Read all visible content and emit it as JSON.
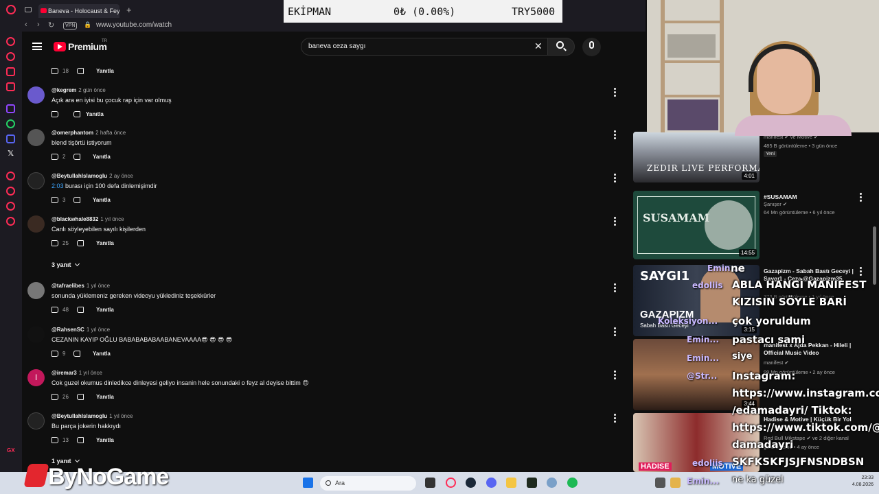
{
  "browser": {
    "tab_title": "Baneva - Holocaust & Feyz",
    "new_tab": "+",
    "vpn": "VPN",
    "url": "www.youtube.com/watch",
    "back": "‹",
    "forward": "›",
    "reload": "↻"
  },
  "youtube": {
    "brand": "Premium",
    "region": "TR",
    "search_query": "baneva ceza saygı",
    "clear": "✕"
  },
  "comments": [
    {
      "likes": "18",
      "reply": "Yanıtla"
    },
    {
      "handle": "@kegrem",
      "time": "2 gün önce",
      "text": "Açık ara en iyisi bu çocuk rap için var olmuş",
      "likes": "",
      "reply": "Yanıtla"
    },
    {
      "handle": "@omerphantom",
      "time": "2 hafta önce",
      "text": "blend tişörtü istiyorum",
      "likes": "2",
      "reply": "Yanıtla"
    },
    {
      "handle": "@BeytullahIslamoglu",
      "time": "2 ay önce",
      "timestamp": "2:03",
      "text": " burası için 100 defa dinlemişimdir",
      "likes": "3",
      "reply": "Yanıtla"
    },
    {
      "handle": "@blackwhale8832",
      "time": "1 yıl önce",
      "text": "Canlı söyleyebilen sayılı kişilerden",
      "likes": "25",
      "reply": "Yanıtla",
      "replies": "3 yanıt"
    },
    {
      "handle": "@tafraelibes",
      "time": "1 yıl önce",
      "text": "sonunda yüklemeniz gereken videoyu yüklediniz teşekkürler",
      "likes": "48",
      "reply": "Yanıtla"
    },
    {
      "handle": "@RahsenSC",
      "time": "1 yıl önce",
      "text": "CEZANIN KAYIP OĞLU BABABABABAABANEVAAAA😎 😎 😎 😎",
      "likes": "9",
      "reply": "Yanıtla"
    },
    {
      "handle": "@iremar3",
      "time": "1 yıl önce",
      "text": "Cok guzel okumus dinledikce dinleyesi geliyo insanin hele sonundaki o feyz al deyise bittim 😍",
      "likes": "26",
      "reply": "Yanıtla",
      "avatar_letter": "I"
    },
    {
      "handle": "@BeytullahIslamoglu",
      "time": "1 yıl önce",
      "text": "Bu parça jokerin hakkıydı",
      "likes": "13",
      "reply": "Yanıtla",
      "replies": "1 yanıt"
    }
  ],
  "recommendations": [
    {
      "channel": "manifest ✔ ve Motive ✔",
      "meta": "485 B görüntüleme • 3 gün önce",
      "badge": "Yeni",
      "duration": "4:01",
      "thumb_text": "ZEDIR LIVE PERFORMANCE"
    },
    {
      "title": "#SUSAMAM",
      "channel": "Şanışer ✔",
      "meta": "64 Mn görüntüleme • 6 yıl önce",
      "duration": "14:55",
      "thumb_text": "SUSAMAM"
    },
    {
      "title": "Gazapizm - Sabah Bastı Geceyi | Saygı1 - Ceza @Gazapizm35",
      "meta": "373 B görüntüleme • 1 yıl önce",
      "duration": "3:15",
      "thumb_text": "SAYGI1",
      "thumb_sub": "GAZAPIZM",
      "thumb_sub2": "Sabah Bastı Geceyi"
    },
    {
      "title": "manifest x Ajda Pekkan - Hileli | Official Music Video",
      "channel": "manifest ✔",
      "meta": "99 Mn görüntüleme • 2 ay önce",
      "duration": "3:44"
    },
    {
      "title": "Hadise & Motive | Küçük Bir Yol",
      "channel": "Red Bull Mikstape ✔ ve 2 diğer kanal",
      "meta": "görüntüleme • 4 ay önce",
      "thumb_text": "HADISE",
      "thumb_text2": "MOTIVE"
    }
  ],
  "stats": {
    "label": "EKİPMAN",
    "value": "0₺ (0.00%)",
    "total": "TRY5000"
  },
  "chat": [
    {
      "name": "Emin...",
      "text": "ne"
    },
    {
      "name": "edoliis",
      "text": "ABLA HANGİ MANIFEST KIZISIN SÖYLE BARİ"
    },
    {
      "name": "Koleksiyon...",
      "text": "çok yoruldum"
    },
    {
      "name": "Emin...",
      "text": "pastacı sami"
    },
    {
      "name": "Emin...",
      "text": "siye"
    },
    {
      "name": "@Str...",
      "text": "Instagram: https://www.instagram.com /edamadayri/ Tiktok: https://www.tiktok.com/@e damadayri"
    },
    {
      "name": "edoliis",
      "text": "SKFKSKFJSJFNSNDBSN"
    },
    {
      "name": "Emin...",
      "text": "ne ka güzel"
    }
  ],
  "chat_lines": [
    "ABLA HANGİ MANIFEST",
    "KIZISIN SÖYLE BARİ",
    "çok yoruldum",
    "pastacı sami",
    "Instagram:",
    "https://www.instagram.com",
    "/edamadayri/ Tiktok:",
    "https://www.tiktok.com/@e",
    "damadayri",
    "SKFKSKFJSJFNSNDBSN",
    "ne ka güzel"
  ],
  "taskbar": {
    "search_placeholder": "Ara",
    "time": "23:33",
    "date": "4.08.2026"
  },
  "watermark": {
    "brand": "ByNoGame"
  },
  "colors": {
    "youtube_red": "#ff0033",
    "opera_red": "#ff2c56",
    "link_blue": "#3ea6ff"
  }
}
